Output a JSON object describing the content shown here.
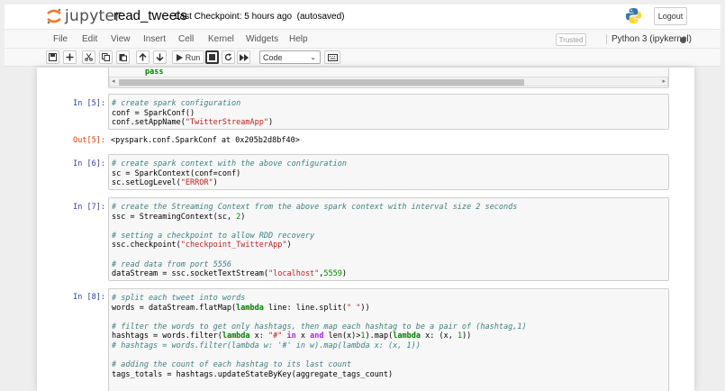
{
  "header": {
    "logo_text": "jupyter",
    "notebook_name": "read_tweets",
    "checkpoint": "Last Checkpoint: 5 hours ago",
    "autosave": "(autosaved)",
    "logout_label": "Logout"
  },
  "menu": {
    "items": [
      "File",
      "Edit",
      "View",
      "Insert",
      "Cell",
      "Kernel",
      "Widgets",
      "Help"
    ],
    "trusted_label": "Trusted",
    "kernel_name": "Python 3 (ipykernel)"
  },
  "toolbar": {
    "run_label": "Run",
    "cell_type": "Code"
  },
  "cells": {
    "prev_tail": "pass",
    "c5": {
      "prompt": "In [5]:",
      "l1": "# create spark configuration",
      "l2": "conf = SparkConf()",
      "l3a": "conf.setAppName(",
      "l3b": "\"TwitterStreamApp\"",
      "l3c": ")",
      "out_prompt": "Out[5]:",
      "output": "<pyspark.conf.SparkConf at 0x205b2d8bf40>"
    },
    "c6": {
      "prompt": "In [6]:",
      "l1": "# create spark context with the above configuration",
      "l2": "sc = SparkContext(conf=conf)",
      "l3a": "sc.setLogLevel(",
      "l3b": "\"ERROR\"",
      "l3c": ")"
    },
    "c7": {
      "prompt": "In [7]:",
      "l1": "# create the Streaming Context from the above spark context with interval size 2 seconds",
      "l2a": "ssc = StreamingContext(sc, ",
      "l2b": "2",
      "l2c": ")",
      "l4": "# setting a checkpoint to allow RDD recovery",
      "l5a": "ssc.checkpoint(",
      "l5b": "\"checkpoint_TwitterApp\"",
      "l5c": ")",
      "l7": "# read data from port 5556",
      "l8a": "dataStream = ssc.socketTextStream(",
      "l8b": "\"localhost\"",
      "l8c": ",",
      "l8d": "5559",
      "l8e": ")"
    },
    "c8": {
      "prompt": "In [8]:",
      "l1": "# split each tweet into words",
      "l2a": "words = dataStream.flatMap(",
      "l2b": "lambda",
      "l2c": " line: line.split(",
      "l2d": "\" \"",
      "l2e": "))",
      "l4": "# filter the words to get only hashtags, then map each hashtag to be a pair of (hashtag,1)",
      "l5a": "hashtags = words.filter(",
      "l5b": "lambda",
      "l5c": " x: ",
      "l5d": "\"#\"",
      "l5e": " in",
      "l5f": " x ",
      "l5g": "and",
      "l5h": " len(x)>",
      "l5i": "1",
      "l5j": ").map(",
      "l5k": "lambda",
      "l5l": " x: (x, ",
      "l5m": "1",
      "l5n": "))",
      "l6": "# hashtags = words.filter(lambda w: '#' in w).map(lambda x: (x, 1))",
      "l8": "# adding the count of each hashtag to its last count",
      "l9": "tags_totals = hashtags.updateStateByKey(aggregate_tags_count)"
    }
  }
}
